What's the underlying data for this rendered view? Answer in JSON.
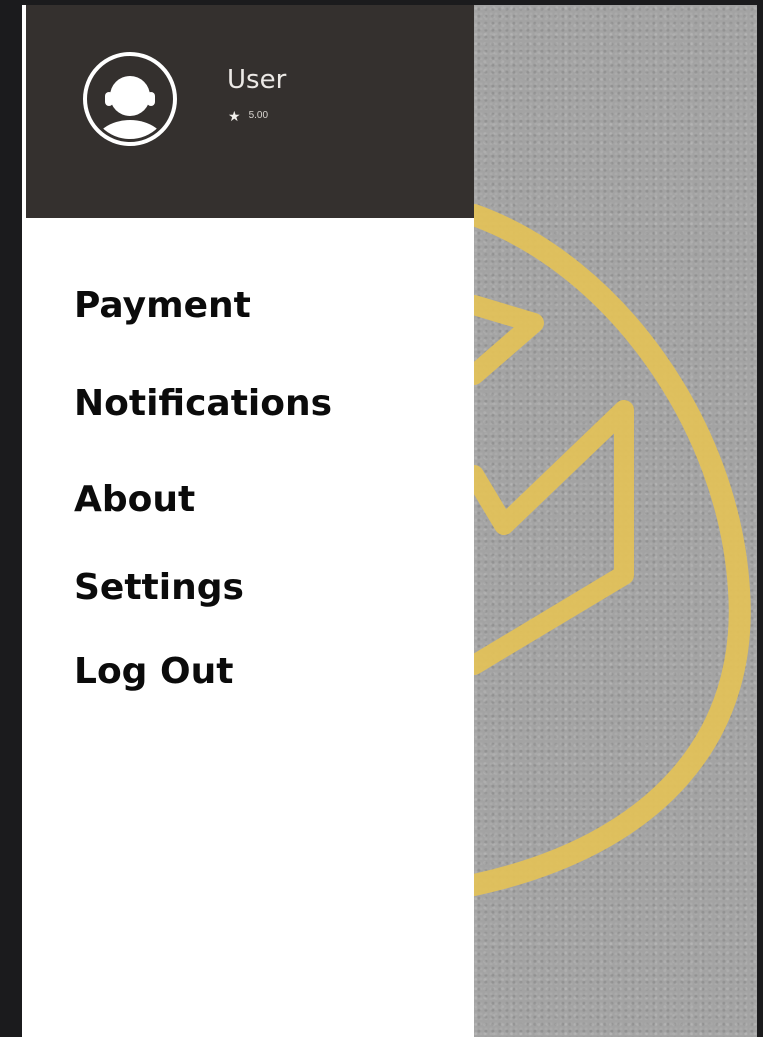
{
  "user": {
    "name": "User",
    "rating": "5.00",
    "avatar_icon": "user-avatar-icon"
  },
  "menu": {
    "items": [
      {
        "label": "Payment"
      },
      {
        "label": "Notifications"
      },
      {
        "label": "About"
      },
      {
        "label": "Settings"
      },
      {
        "label": "Log Out"
      }
    ]
  },
  "colors": {
    "header_bg": "#34302e",
    "drawer_bg": "#ffffff",
    "menu_text": "#0b0b0b",
    "road_bg": "#a3a3a3",
    "road_paint": "#e2c15a"
  }
}
